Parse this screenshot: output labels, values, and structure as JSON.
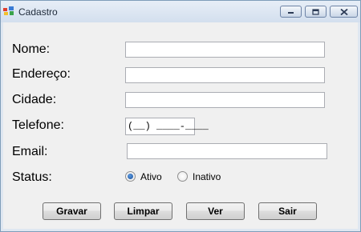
{
  "window": {
    "title": "Cadastro",
    "controls": {
      "minimize_icon": "minimize-icon",
      "maximize_icon": "maximize-icon",
      "close_icon": "close-icon"
    }
  },
  "form": {
    "nome_label": "Nome:",
    "endereco_label": "Endereço:",
    "cidade_label": "Cidade:",
    "telefone_label": "Telefone:",
    "email_label": "Email:",
    "status_label": "Status:",
    "nome_value": "",
    "endereco_value": "",
    "cidade_value": "",
    "telefone_mask": "(__) ____-____",
    "email_value": "",
    "status_options": [
      {
        "label": "Ativo",
        "selected": true
      },
      {
        "label": "Inativo",
        "selected": false
      }
    ]
  },
  "buttons": {
    "gravar": "Gravar",
    "limpar": "Limpar",
    "ver": "Ver",
    "sair": "Sair"
  },
  "colors": {
    "titlebar": "#dbe5f2",
    "client_background": "#f0f0f0",
    "close_button": "#c9d6e7"
  }
}
